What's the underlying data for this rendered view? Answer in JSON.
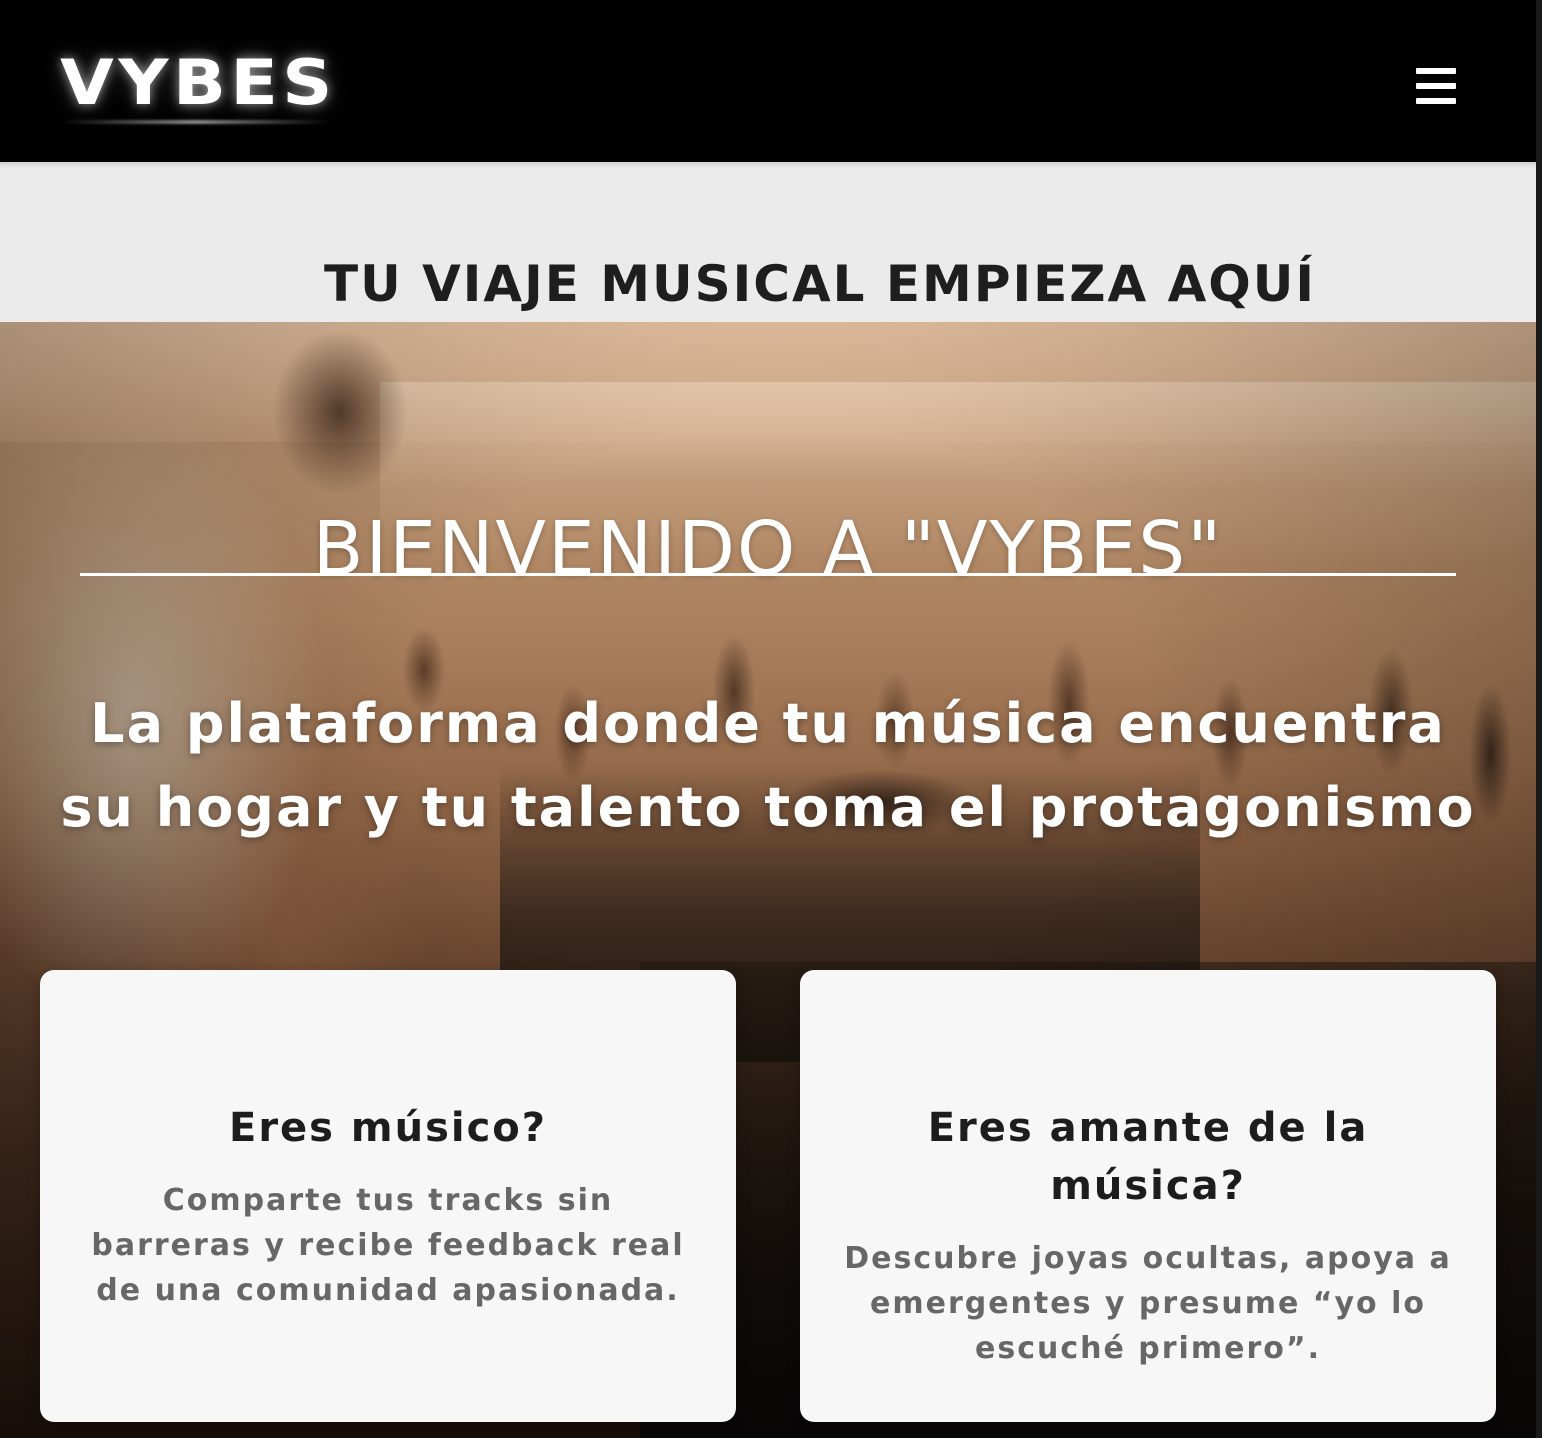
{
  "header": {
    "logo_text": "VYBES",
    "menu_icon": "hamburger-menu-icon"
  },
  "banner": {
    "title": "TU VIAJE MUSICAL EMPIEZA AQUÍ"
  },
  "hero": {
    "title": "BIENVENIDO A \"VYBES\"",
    "subtitle": "La plataforma donde tu música encuentra su hogar y tu talento toma el protagonismo"
  },
  "cards": [
    {
      "title": "Eres músico?",
      "text": "Comparte tus tracks sin barreras y recibe feedback real de una comunidad apasionada."
    },
    {
      "title": "Eres amante de la música?",
      "text": "Descubre joyas ocultas, apoya a emergentes y presume “yo lo escuché primero”."
    }
  ],
  "colors": {
    "header_bg": "#000000",
    "banner_bg": "#ebebeb",
    "card_bg": "#f7f7f7",
    "card_title": "#1d1d1d",
    "card_text": "#676767",
    "hero_text": "#ffffff"
  }
}
